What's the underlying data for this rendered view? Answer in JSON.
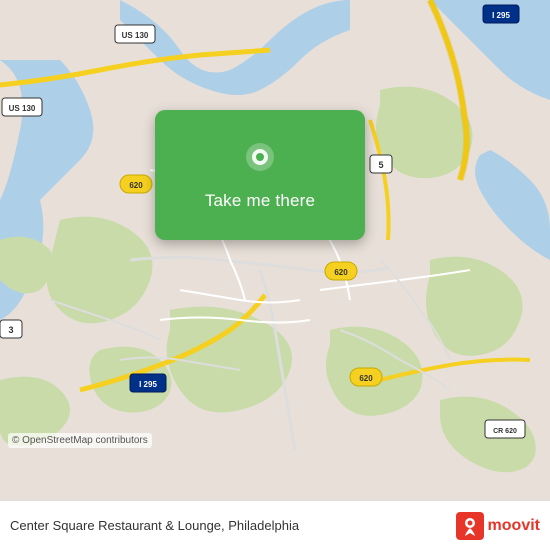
{
  "map": {
    "attribution": "© OpenStreetMap contributors",
    "background_color": "#e8e0d8"
  },
  "card": {
    "button_label": "Take me there",
    "icon": "location-pin-icon"
  },
  "bottom_bar": {
    "venue_name": "Center Square Restaurant & Lounge, Philadelphia",
    "app_name": "moovit"
  }
}
